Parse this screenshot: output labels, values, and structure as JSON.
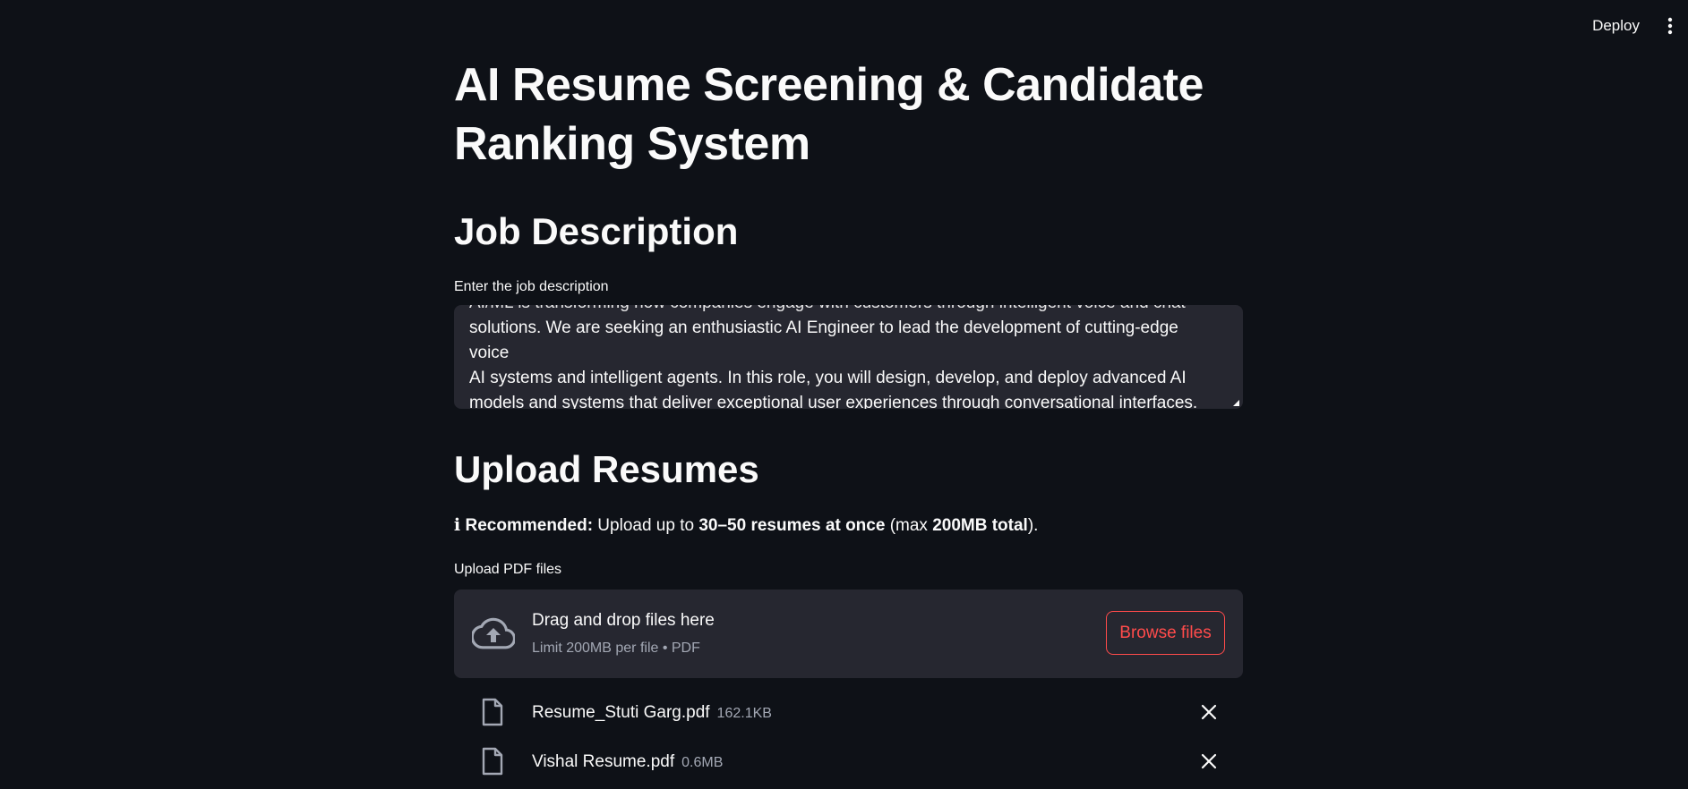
{
  "toolbar": {
    "deploy_label": "Deploy",
    "menu_icon": "more-vertical-icon"
  },
  "title": "AI Resume Screening & Candidate Ranking System",
  "job_section": {
    "heading": "Job Description",
    "field_label": "Enter the job description",
    "field_value": "  solutions. We are seeking an enthusiastic AI Engineer to lead the development of cutting-edge voice AI systems and intelligent agents. In this role, you will design, develop, and deploy advanced AI models and systems that deliver exceptional user experiences through conversational interfaces.",
    "field_value_lines": [
      "solutions. We are seeking an enthusiastic AI Engineer to lead the development of cutting-edge voice",
      "AI systems and intelligent agents. In this role, you will design, develop, and deploy advanced AI",
      "models and systems that deliver exceptional user experiences through conversational interfaces."
    ]
  },
  "upload_section": {
    "heading": "Upload Resumes",
    "info_icon": "ℹ",
    "info_bold_1": "Recommended:",
    "info_text_1": " Upload up to ",
    "info_bold_2": "30–50 resumes at once",
    "info_text_2": " (max ",
    "info_bold_3": "200MB total",
    "info_text_3": ").",
    "field_label": "Upload PDF files",
    "dropzone_title": "Drag and drop files here",
    "dropzone_subtitle": "Limit 200MB per file • PDF",
    "browse_label": "Browse files",
    "files": [
      {
        "name": "Resume_Stuti Garg.pdf",
        "size": "162.1KB"
      },
      {
        "name": "Vishal Resume.pdf",
        "size": "0.6MB"
      }
    ]
  },
  "colors": {
    "background": "#0e1117",
    "surface": "#262730",
    "accent": "#ff4b4b",
    "muted_text": "#a3a8b4"
  }
}
